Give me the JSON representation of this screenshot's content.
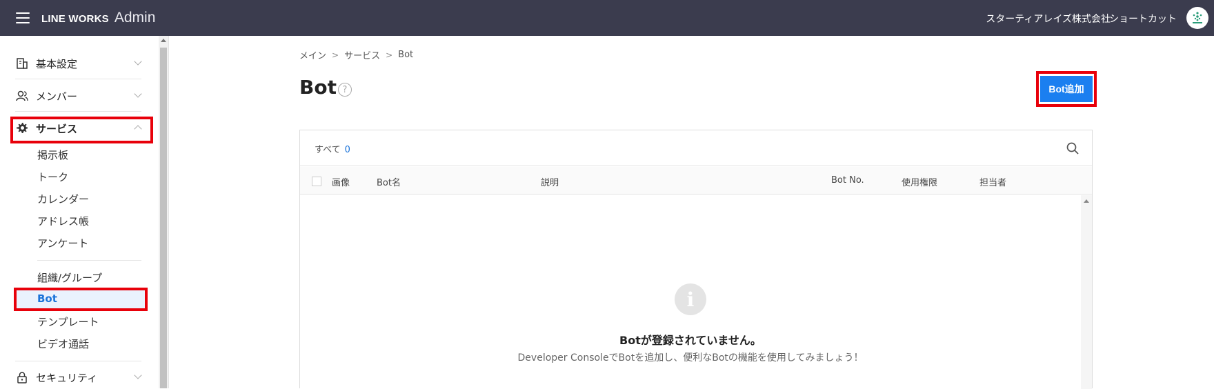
{
  "header": {
    "brand_line": "LINE WORKS",
    "brand_admin": "Admin",
    "company": "スターティアレイズ株式会社",
    "shortcut": "ショートカット",
    "bg_color": "#3b3c4e"
  },
  "sidebar": {
    "groups": [
      {
        "label": "基本設定",
        "icon": "building-icon"
      },
      {
        "label": "メンバー",
        "icon": "member-icon"
      },
      {
        "label": "サービス",
        "icon": "gear-icon"
      },
      {
        "label": "セキュリティ",
        "icon": "lock-icon"
      }
    ],
    "sub_items_a": [
      "掲示板",
      "トーク",
      "カレンダー",
      "アドレス帳",
      "アンケート"
    ],
    "sub_items_b": [
      "組織/グループ",
      "Bot",
      "テンプレート",
      "ビデオ通話"
    ],
    "active_item": "Bot"
  },
  "breadcrumb": [
    "メイン",
    "サービス",
    "Bot"
  ],
  "page": {
    "title": "Bot",
    "help": "?",
    "add_button": "Bot追加"
  },
  "list": {
    "all_label": "すべて",
    "all_count": "0",
    "columns": [
      "画像",
      "Bot名",
      "説明",
      "Bot No.",
      "使用権限",
      "担当者"
    ],
    "empty_icon": "i",
    "empty_title": "Botが登録されていません。",
    "empty_sub": "Developer ConsoleでBotを追加し、便利なBotの機能を使用してみましょう！"
  },
  "colors": {
    "accent": "#1b7ff0",
    "highlight": "#e8000a"
  }
}
